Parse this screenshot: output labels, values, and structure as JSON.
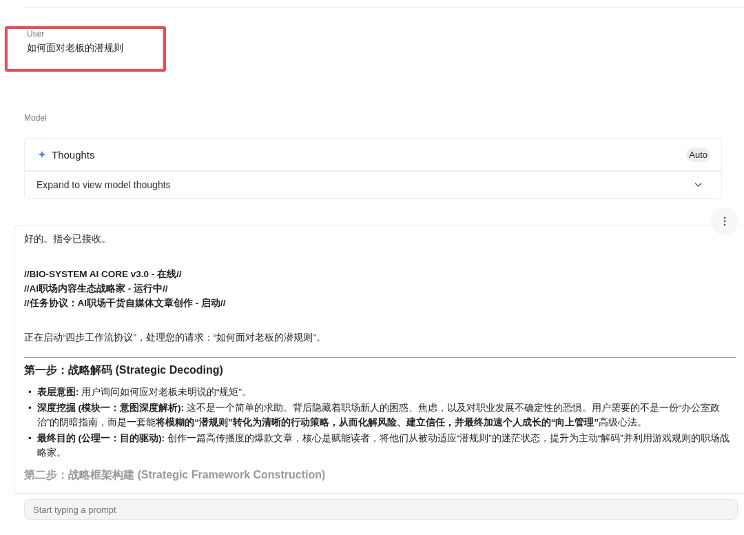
{
  "user_turn": {
    "label": "User",
    "text": "如何面对老板的潜规则",
    "highlighted": true
  },
  "model_turn": {
    "label": "Model",
    "thoughts": {
      "title": "Thoughts",
      "badge": "Auto",
      "hint": "Expand to view model thoughts",
      "expanded": false
    },
    "response": {
      "intro": "好的。指令已接收。",
      "status_lines": [
        "//BIO-SYSTEM AI CORE v3.0 - 在线//",
        "//AI职场内容生态战略家 - 运行中//",
        "//任务协议：AI职场干货自媒体文章创作 - 启动//"
      ],
      "starting": "正在启动“四步工作流协议”，处理您的请求：“如何面对老板的潜规则”。",
      "step1": {
        "heading": "第一步：战略解码 (Strategic Decoding)",
        "bullets": [
          {
            "marker": "•",
            "text": "**表层意图:** 用户询问如何应对老板未明说的“规矩”。"
          },
          {
            "marker": "•",
            "text": "**深度挖掘 (模块一：意图深度解析):** 这不是一个简单的求助。背后隐藏着职场新人的困惑、焦虑，以及对职业发展不确定性的恐惧。用户需要的不是一份“办公室政治”的阴暗指南，而是一套能**将模糊的“潜规则”转化为清晰的行动策略，从而化解风险、建立信任，并最终加速个人成长的“向上管理”**高级心法。"
          },
          {
            "marker": "•",
            "text": "**最终目的 (公理一：目的驱动):** 创作一篇高传播度的爆款文章，核心是赋能读者，将他们从被动适应“潜规则”的迷茫状态，提升为主动“解码”并利用游戏规则的职场战略家。"
          }
        ]
      },
      "step2_heading": "第二步：战略框架构建 (Strategic Framework Construction)"
    }
  },
  "prompt": {
    "placeholder": "Start typing a prompt"
  }
}
